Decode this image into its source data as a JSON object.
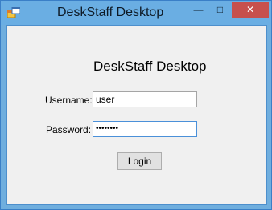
{
  "window": {
    "title": "DeskStaff Desktop",
    "controls": {
      "minimize": "—",
      "maximize": "□",
      "close": "✕"
    }
  },
  "form": {
    "heading": "DeskStaff Desktop",
    "username_label": "Username:",
    "username_value": "user",
    "password_label": "Password:",
    "password_value": "••••••••",
    "login_label": "Login"
  },
  "icons": {
    "app": "app-window-icon"
  },
  "colors": {
    "titlebar": "#6aaee3",
    "close_button": "#c7504d",
    "client_background": "#f0f0f0",
    "focus_border": "#4a90d9"
  }
}
